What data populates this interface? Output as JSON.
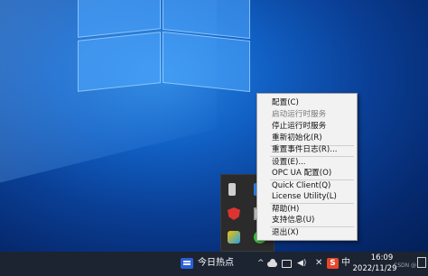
{
  "context_menu": {
    "items": [
      {
        "label": "配置(C)",
        "enabled": true
      },
      {
        "label": "启动运行时服务",
        "enabled": false
      },
      {
        "label": "停止运行时服务",
        "enabled": true
      },
      {
        "label": "重新初始化(R)",
        "enabled": true
      },
      {
        "label": "重置事件日志(R)...",
        "enabled": true
      },
      {
        "label": "设置(E)...",
        "enabled": true
      },
      {
        "label": "OPC UA 配置(O)",
        "enabled": true
      },
      {
        "label": "Quick Client(Q)",
        "enabled": true
      },
      {
        "label": "License Utility(L)",
        "enabled": true
      },
      {
        "label": "帮助(H)",
        "enabled": true
      },
      {
        "label": "支持信息(U)",
        "enabled": true
      },
      {
        "label": "退出(X)",
        "enabled": true
      }
    ]
  },
  "taskbar": {
    "news_label": "今日热点",
    "chevron": "^",
    "ime_label": "中",
    "sogou_label": "S",
    "close_glyph": "✕",
    "volume_glyph": "◀)",
    "clock_time": "16:09",
    "clock_date": "2022/11/29",
    "watermark": "CSDN @"
  },
  "tray_icons": [
    "pen-icon",
    "blue-app-icon",
    "shield-icon",
    "image-icon",
    "app-icon",
    "wechat-icon"
  ]
}
